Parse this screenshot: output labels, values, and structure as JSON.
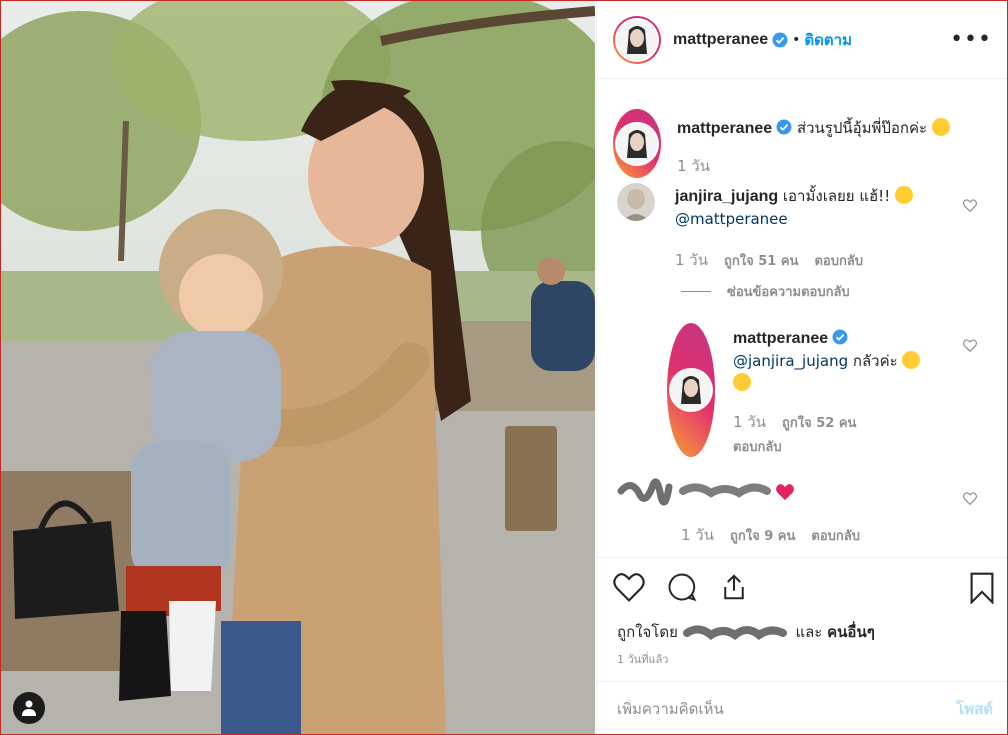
{
  "post": {
    "username": "mattperanee",
    "follow_label": "ติดตาม",
    "separator": "•",
    "more_label": "•••"
  },
  "caption": {
    "username": "mattperanee",
    "text": "ส่วนรูปนี้อุ้มพี่ป๊อกค่ะ",
    "time": "1 วัน"
  },
  "comments": [
    {
      "username": "janjira_jujang",
      "text": "เอามั้งเลยย แฮ้!!",
      "mention": "@mattperanee",
      "time": "1 วัน",
      "likes": "ถูกใจ 51 คน",
      "reply_label": "ตอบกลับ",
      "view_replies": "ซ่อนข้อความตอบกลับ"
    },
    {
      "username": "mattperanee",
      "mention": "@janjira_jujang",
      "text": "กลัวค่ะ",
      "time": "1 วัน",
      "likes": "ถูกใจ 52 คน",
      "reply_label": "ตอบกลับ"
    },
    {
      "time": "1 วัน",
      "likes": "ถูกใจ 9 คน",
      "reply_label": "ตอบกลับ"
    }
  ],
  "footer": {
    "liked_by_prefix": "ถูกใจโดย",
    "liked_by_and": "และ",
    "liked_by_others": "คนอื่นๆ",
    "posted_ago": "1 วันที่แล้ว",
    "comment_placeholder": "เพิ่มความคิดเห็น",
    "post_button": "โพสต์"
  },
  "colors": {
    "accent": "#0095f6",
    "heart_red": "#ed4956",
    "ring_start": "#f9a334",
    "ring_end": "#c13584"
  },
  "icons": [
    "verified-badge-icon",
    "more-options-icon",
    "heart-icon",
    "comment-icon",
    "share-icon",
    "bookmark-icon",
    "tag-user-icon"
  ]
}
